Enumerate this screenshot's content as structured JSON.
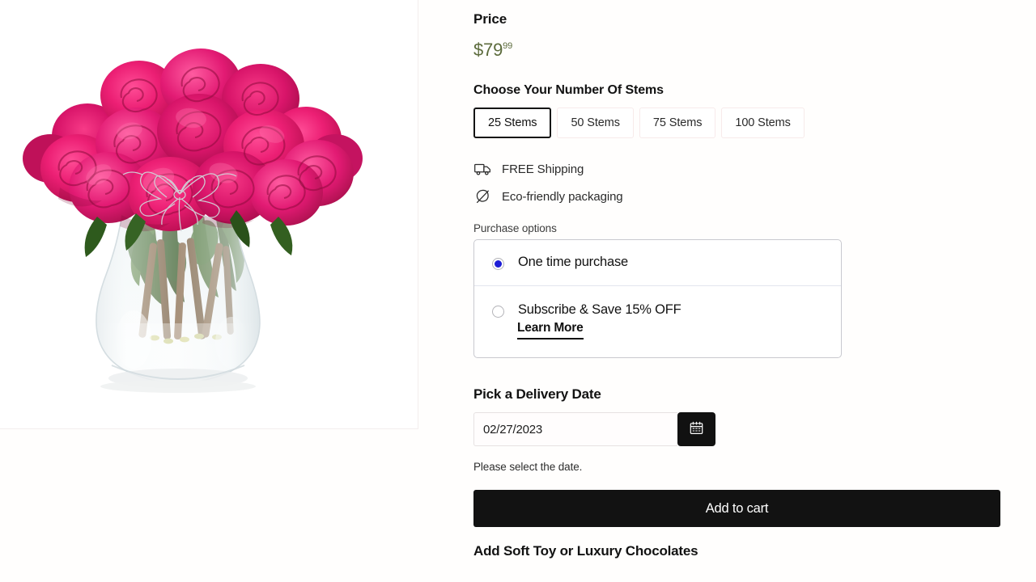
{
  "product_media": {
    "alt": "Pink roses bouquet in clear glass vase",
    "icon": "product-image"
  },
  "price": {
    "label": "Price",
    "amount": "$79",
    "cents": "99",
    "color": "#5c6b3c"
  },
  "stems": {
    "heading": "Choose Your Number Of Stems",
    "options": [
      {
        "label": "25 Stems",
        "selected": true
      },
      {
        "label": "50 Stems",
        "selected": false
      },
      {
        "label": "75 Stems",
        "selected": false
      },
      {
        "label": "100 Stems",
        "selected": false
      }
    ]
  },
  "perks": [
    {
      "icon": "truck-icon",
      "text": "FREE Shipping"
    },
    {
      "icon": "leaf-icon",
      "text": "Eco-friendly packaging"
    }
  ],
  "purchase_options": {
    "legend": "Purchase options",
    "one_time": {
      "label": "One time purchase",
      "selected": true
    },
    "subscribe": {
      "label": "Subscribe & Save 15% OFF",
      "selected": false
    },
    "learn_more": "Learn More"
  },
  "delivery": {
    "heading": "Pick a Delivery Date",
    "value": "02/27/2023",
    "placeholder": "MM/DD/YYYY",
    "calendar_icon": "calendar-icon",
    "help_text": "Please select the date."
  },
  "cart": {
    "add_to_cart_label": "Add to cart"
  },
  "upsell": {
    "heading": "Add Soft Toy or Luxury Chocolates"
  }
}
